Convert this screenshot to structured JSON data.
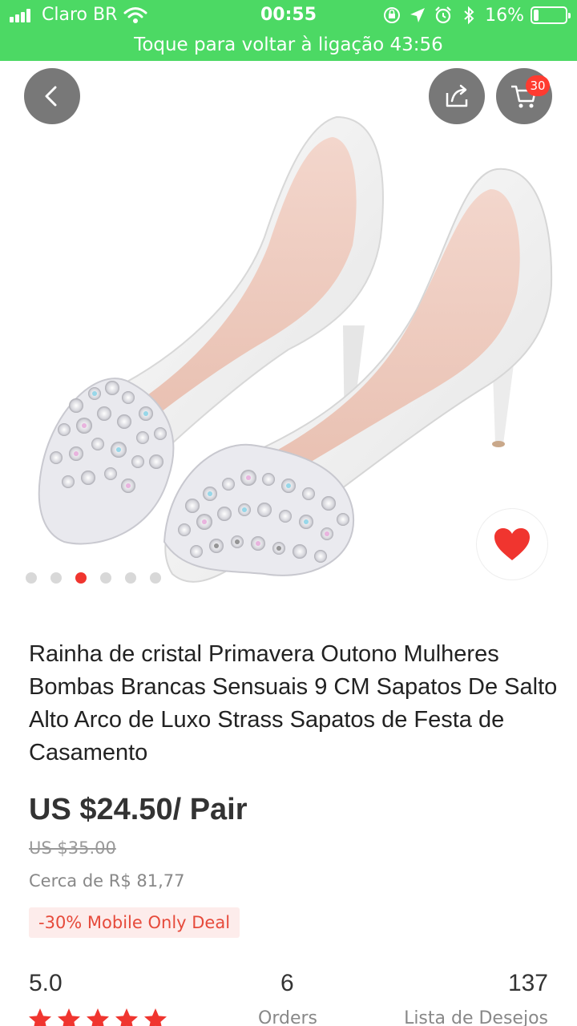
{
  "status_bar": {
    "carrier": "Claro BR",
    "time": "00:55",
    "battery_percent": "16%",
    "battery_level": 0.16,
    "call_banner": "Toque para voltar à ligação 43:56"
  },
  "header": {
    "cart_count": "30",
    "icons": [
      "back-icon",
      "share-icon",
      "cart-icon"
    ]
  },
  "gallery": {
    "image_count": 6,
    "active_index": 2
  },
  "product": {
    "title": "Rainha de cristal Primavera Outono Mulheres Bombas Brancas Sensuais 9 CM Sapatos De Salto Alto Arco de Luxo Strass Sapatos de Festa de Casamento",
    "price": "US $24.50/ Pair",
    "original_price": "US $35.00",
    "approx_local_price": "Cerca de R$ 81,77",
    "deal_badge": "-30% Mobile Only Deal"
  },
  "stats": {
    "rating": "5.0",
    "rating_stars": 5,
    "orders_value": "6",
    "orders_label": "Orders",
    "wishlist_value": "137",
    "wishlist_label": "Lista de Desejos"
  },
  "colors": {
    "status_bar": "#4cd964",
    "accent_red": "#f0352f",
    "deal_bg": "#fdeceb",
    "deal_text": "#e64a3b"
  }
}
